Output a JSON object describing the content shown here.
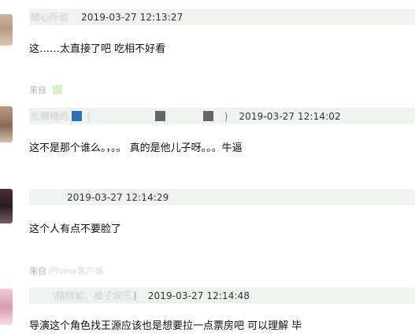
{
  "comments": [
    {
      "username": "随心所欲",
      "timestamp": "2019-03-27 12:13:27",
      "text": "这……太直接了吧 吃相不好看"
    },
    {
      "username": "乱糟糟的",
      "extra": "(",
      "close": ")",
      "timestamp": "2019-03-27 12:14:02",
      "text": "这不是那个谁么。，。。 真的是他儿子呀。。。牛逼"
    },
    {
      "username": "",
      "timestamp": "2019-03-27 12:14:29",
      "text": "这个人有点不要脸了"
    },
    {
      "username": "\\精精如，橘子娱乐",
      "close": ")",
      "timestamp": "2019-03-27 12:14:48",
      "text": "导演这个角色找王源应该也是想要拉一点票房吧 可以理解 毕"
    }
  ],
  "sources": [
    {
      "label": "来自",
      "app": ""
    },
    {
      "label": "来自",
      "app": "iPhone客户端"
    }
  ]
}
